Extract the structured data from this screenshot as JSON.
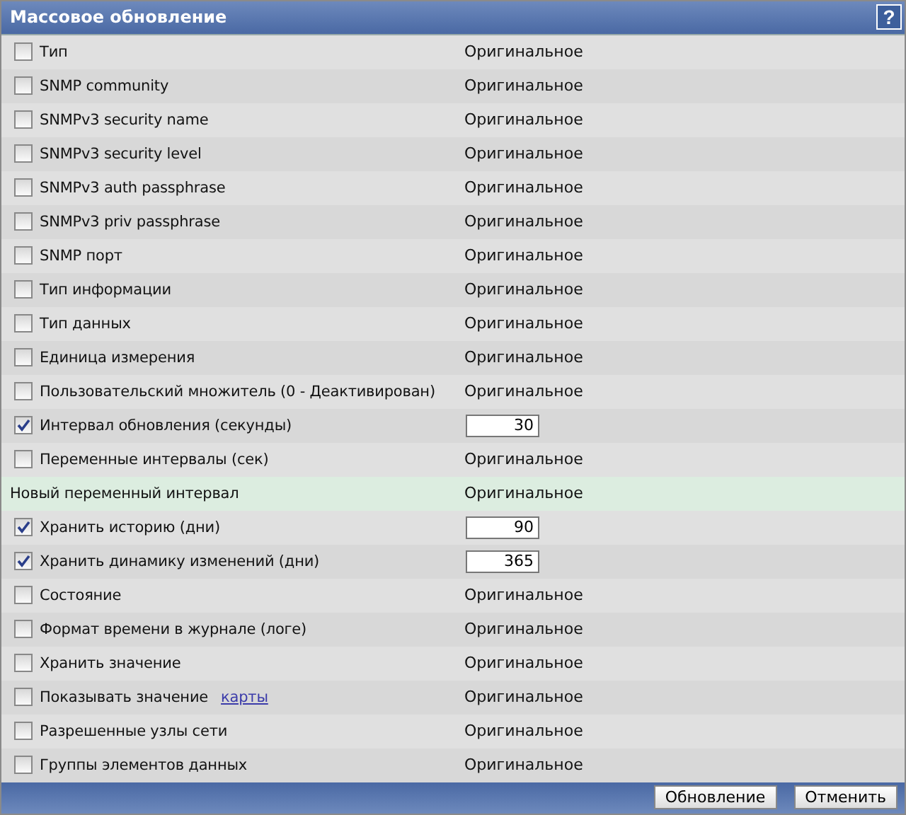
{
  "window": {
    "title": "Массовое обновление",
    "help": "?"
  },
  "rows": [
    {
      "kind": "checkbox",
      "label": "Тип",
      "checked": false,
      "value": "Оригинальное"
    },
    {
      "kind": "checkbox",
      "label": "SNMP community",
      "checked": false,
      "value": "Оригинальное"
    },
    {
      "kind": "checkbox",
      "label": "SNMPv3 security name",
      "checked": false,
      "value": "Оригинальное"
    },
    {
      "kind": "checkbox",
      "label": "SNMPv3 security level",
      "checked": false,
      "value": "Оригинальное"
    },
    {
      "kind": "checkbox",
      "label": "SNMPv3 auth passphrase",
      "checked": false,
      "value": "Оригинальное"
    },
    {
      "kind": "checkbox",
      "label": "SNMPv3 priv passphrase",
      "checked": false,
      "value": "Оригинальное"
    },
    {
      "kind": "checkbox",
      "label": "SNMP порт",
      "checked": false,
      "value": "Оригинальное"
    },
    {
      "kind": "checkbox",
      "label": "Тип информации",
      "checked": false,
      "value": "Оригинальное"
    },
    {
      "kind": "checkbox",
      "label": "Тип данных",
      "checked": false,
      "value": "Оригинальное"
    },
    {
      "kind": "checkbox",
      "label": "Единица измерения",
      "checked": false,
      "value": "Оригинальное"
    },
    {
      "kind": "checkbox",
      "label": "Пользовательский множитель (0 - Деактивирован)",
      "checked": false,
      "value": "Оригинальное"
    },
    {
      "kind": "checkbox",
      "label": "Интервал обновления (секунды)",
      "checked": true,
      "input": "30"
    },
    {
      "kind": "checkbox",
      "label": "Переменные интервалы (сек)",
      "checked": false,
      "value": "Оригинальное"
    },
    {
      "kind": "plain",
      "label": "Новый переменный интервал",
      "value": "Оригинальное"
    },
    {
      "kind": "checkbox",
      "label": "Хранить историю (дни)",
      "checked": true,
      "input": "90"
    },
    {
      "kind": "checkbox",
      "label": "Хранить динамику изменений (дни)",
      "checked": true,
      "input": "365"
    },
    {
      "kind": "checkbox",
      "label": "Состояние",
      "checked": false,
      "value": "Оригинальное"
    },
    {
      "kind": "checkbox",
      "label": "Формат времени в журнале (логе)",
      "checked": false,
      "value": "Оригинальное"
    },
    {
      "kind": "checkbox",
      "label": "Хранить значение",
      "checked": false,
      "value": "Оригинальное"
    },
    {
      "kind": "checkbox",
      "label": "Показывать значение",
      "link": "карты",
      "checked": false,
      "value": "Оригинальное"
    },
    {
      "kind": "checkbox",
      "label": "Разрешенные узлы сети",
      "checked": false,
      "value": "Оригинальное"
    },
    {
      "kind": "checkbox",
      "label": "Группы элементов данных",
      "checked": false,
      "value": "Оригинальное"
    }
  ],
  "buttons": [
    "Обновление",
    "Отменить"
  ]
}
